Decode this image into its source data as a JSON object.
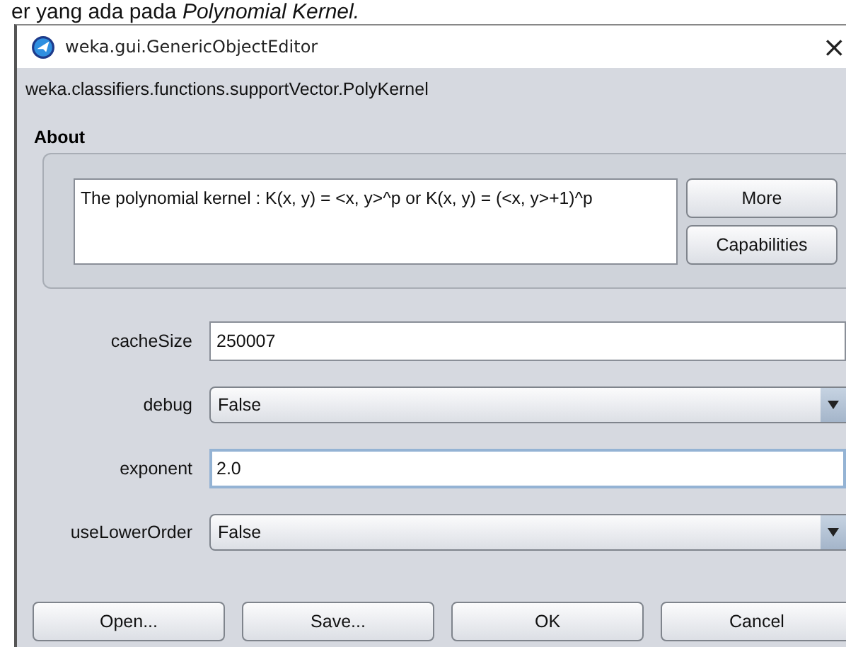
{
  "caption": "er yang ada pada *Polynomial Kernel.*",
  "window": {
    "title": "weka.gui.GenericObjectEditor",
    "close": "×"
  },
  "class_name": "weka.classifiers.functions.supportVector.PolyKernel",
  "about": {
    "heading": "About",
    "description": "The polynomial kernel : K(x, y) = <x, y>^p or K(x, y) = (<x, y>+1)^p",
    "buttons": [
      "More",
      "Capabilities"
    ]
  },
  "properties": [
    {
      "label": "cacheSize",
      "kind": "text",
      "value": "250007",
      "focused": false
    },
    {
      "label": "debug",
      "kind": "dropdown",
      "value": "False"
    },
    {
      "label": "exponent",
      "kind": "text",
      "value": "2.0",
      "focused": true
    },
    {
      "label": "useLowerOrder",
      "kind": "dropdown",
      "value": "False"
    }
  ],
  "buttons": [
    "Open...",
    "Save...",
    "OK",
    "Cancel"
  ]
}
